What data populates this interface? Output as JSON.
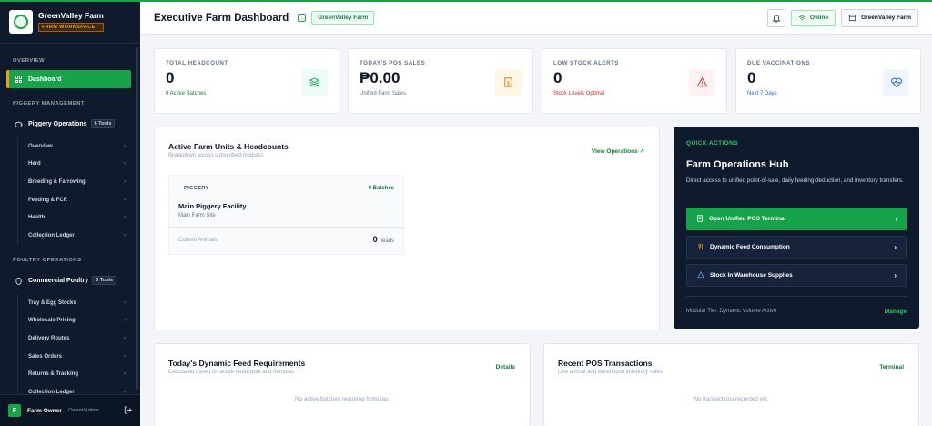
{
  "brand": {
    "name": "GreenValley Farm",
    "badge": "FARM WORKSPACE"
  },
  "sidebar": {
    "overview_title": "OVERVIEW",
    "dashboard_label": "Dashboard",
    "piggery_section": "PIGGERY MANAGEMENT",
    "piggery_group": {
      "label": "Piggery Operations",
      "badge": "6 Tools"
    },
    "piggery_items": [
      "Overview",
      "Herd",
      "Breeding & Farrowing",
      "Feeding & FCR",
      "Health",
      "Collection Ledger"
    ],
    "poultry_section": "POULTRY OPERATIONS",
    "poultry_group": {
      "label": "Commercial Poultry",
      "badge": "6 Tools"
    },
    "poultry_items": [
      "Tray & Egg Stocks",
      "Wholesale Pricing",
      "Delivery Routes",
      "Sales Orders",
      "Returns & Tracking",
      "Collection Ledger"
    ],
    "user": {
      "initial": "F",
      "name": "Farm Owner",
      "role": "· Owner/Admin"
    }
  },
  "header": {
    "title": "Executive Farm Dashboard",
    "farm_chip": "GreenValley Farm",
    "online_label": "Online",
    "farm_button": "GreenValley Farm"
  },
  "stats": [
    {
      "label": "TOTAL HEADCOUNT",
      "value": "0",
      "sub": "0 Active Batches",
      "sub_color": "#15803d",
      "icon": "layers-icon",
      "icon_bg": "#ecfdf5",
      "icon_color": "#16a34a"
    },
    {
      "label": "TODAY'S POS SALES",
      "value": "₱0.00",
      "sub": "Unified Farm Sales",
      "sub_color": "#64748b",
      "icon": "cash-icon",
      "icon_bg": "#fff7e6",
      "icon_color": "#d97706"
    },
    {
      "label": "LOW STOCK ALERTS",
      "value": "0",
      "sub": "Stock Levels Optimal",
      "sub_color": "#dc2626",
      "icon": "warning-icon",
      "icon_bg": "#fef2f2",
      "icon_color": "#dc2626"
    },
    {
      "label": "DUE VACCINATIONS",
      "value": "0",
      "sub": "Next 7 Days",
      "sub_color": "#2563eb",
      "icon": "heart-pulse-icon",
      "icon_bg": "#eff6ff",
      "icon_color": "#2563eb"
    }
  ],
  "units": {
    "title": "Active Farm Units & Headcounts",
    "subtitle": "Breakdown across subscribed modules",
    "link": "View Operations",
    "card": {
      "tag": "PIGGERY",
      "batches": "0 Batches",
      "name": "Main Piggery Facility",
      "site": "Main Farm Site",
      "current_label": "Current Animals",
      "count": "0",
      "count_unit": "heads"
    }
  },
  "quick_actions": {
    "label": "QUICK ACTIONS",
    "title": "Farm Operations Hub",
    "desc": "Direct access to unified point-of-sale, daily feeding deduction, and inventory transfers.",
    "buttons": [
      "Open Unified POS Terminal",
      "Dynamic Feed Consumption",
      "Stock In Warehouse Supplies"
    ],
    "footer": "Modular Tier: Dynamic Volume Active",
    "manage": "Manage"
  },
  "feed": {
    "title": "Today's Dynamic Feed Requirements",
    "subtitle": "Calculated based on active headcount and formulas",
    "link": "Details",
    "empty": "No active batches requiring formulas."
  },
  "pos": {
    "title": "Recent POS Transactions",
    "subtitle": "Live animal and warehouse inventory sales",
    "link": "Terminal",
    "empty": "No transactions recorded yet."
  }
}
